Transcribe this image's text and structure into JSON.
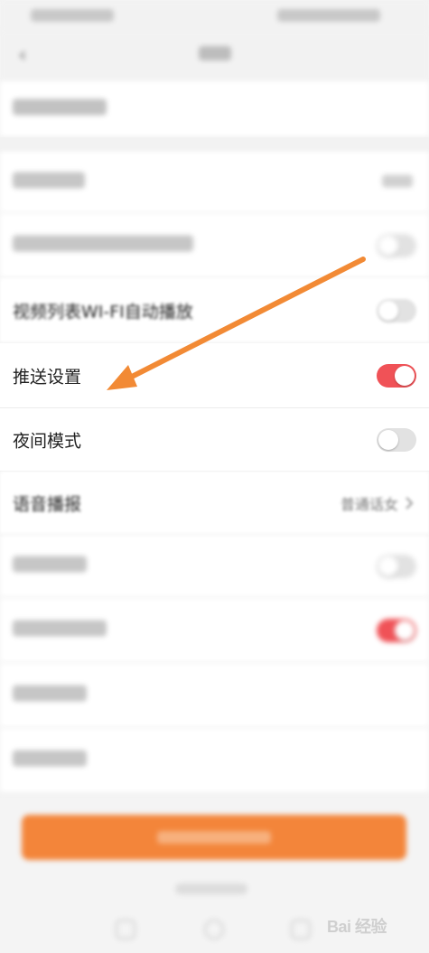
{
  "settings": {
    "wifi_autoplay": {
      "label": "视频列表WI-FI自动播放",
      "toggle_on": false
    },
    "push": {
      "label": "推送设置",
      "toggle_on": true
    },
    "night_mode": {
      "label": "夜间模式",
      "toggle_on": false
    },
    "voice": {
      "label": "语音播报",
      "value": "普通话女"
    }
  },
  "watermark": {
    "text": "Bai 经验"
  },
  "colors": {
    "accent_toggle_on": "#f05257",
    "arrow": "#f28a35",
    "bottom_button": "#f3853a"
  }
}
